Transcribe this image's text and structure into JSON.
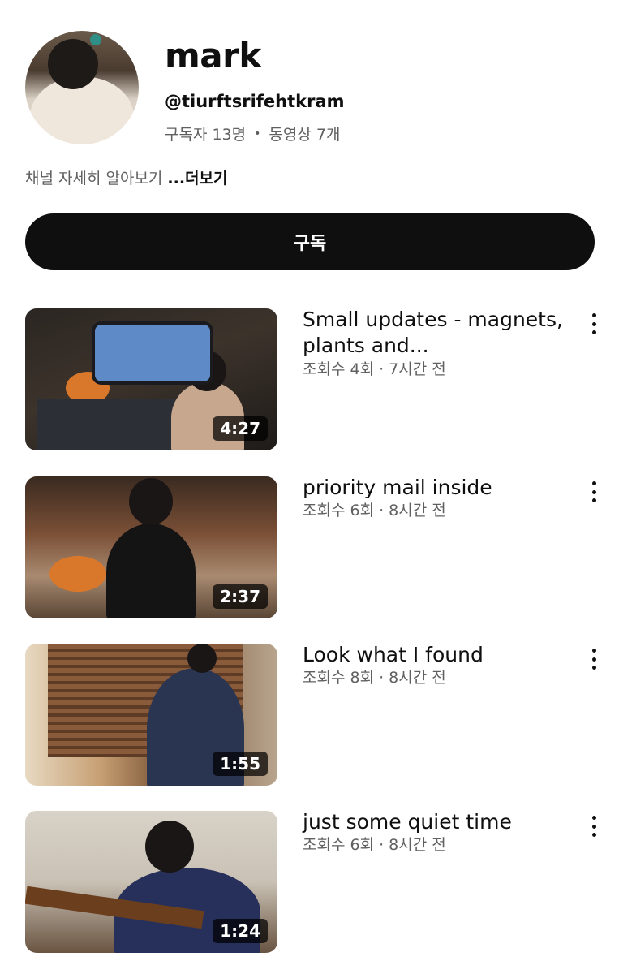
{
  "channel": {
    "name": "mark",
    "handle": "@tiurftsrifehtkram",
    "subscribers": "구독자 13명",
    "separator": "•",
    "videos_count": "동영상 7개",
    "description": "채널 자세히 알아보기",
    "more_label": "...더보기",
    "subscribe_label": "구독"
  },
  "videos": [
    {
      "title": "Small updates - magnets, plants and...",
      "meta": "조회수 4회 · 7시간 전",
      "duration": "4:27",
      "menu_icon": "more-vert-icon"
    },
    {
      "title": "priority mail inside",
      "meta": "조회수 6회 · 8시간 전",
      "duration": "2:37",
      "menu_icon": "more-vert-icon"
    },
    {
      "title": "Look what I found",
      "meta": "조회수 8회 · 8시간 전",
      "duration": "1:55",
      "menu_icon": "more-vert-icon"
    },
    {
      "title": "just some quiet time",
      "meta": "조회수 6회 · 8시간 전",
      "duration": "1:24",
      "menu_icon": "more-vert-icon"
    }
  ],
  "colors": {
    "text_primary": "#0f0f0f",
    "text_secondary": "#606060",
    "subscribe_bg": "#0f0f0f",
    "subscribe_text": "#ffffff",
    "background": "#ffffff"
  }
}
